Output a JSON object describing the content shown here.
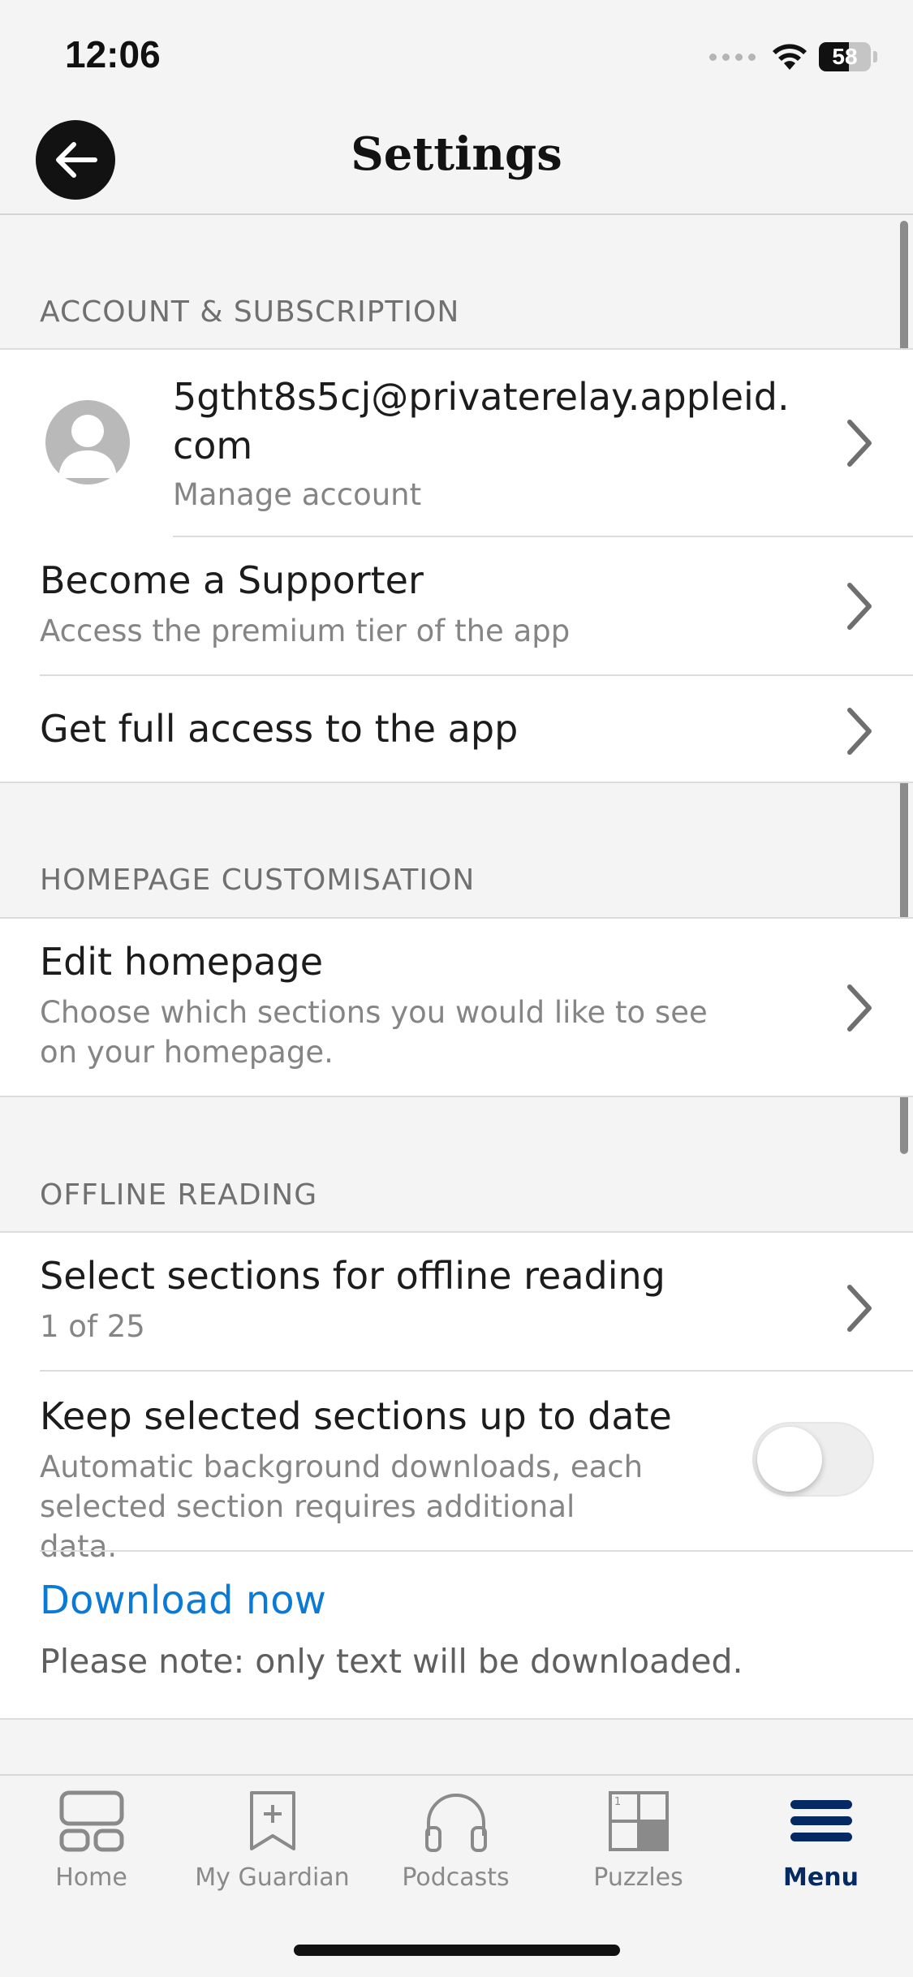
{
  "status_bar": {
    "time": "12:06",
    "battery": "58",
    "battery_level": 0.58,
    "icons": [
      "cellular-signal-icon",
      "wifi-icon",
      "battery-icon"
    ]
  },
  "nav": {
    "title": "Settings",
    "back_icon": "arrow-left-icon"
  },
  "account_section": {
    "header": "ACCOUNT & SUBSCRIPTION",
    "account": {
      "email": "5gtht8s5cj@privaterelay.appleid.com",
      "subtitle": "Manage account"
    },
    "supporter": {
      "title": "Become a Supporter",
      "subtitle": "Access the premium tier of the app"
    },
    "full_access": {
      "title": "Get full access to the app"
    }
  },
  "homepage_section": {
    "header": "HOMEPAGE CUSTOMISATION",
    "edit": {
      "title": "Edit homepage",
      "subtitle": "Choose which sections you would like to see on your homepage."
    }
  },
  "offline_section": {
    "header": "OFFLINE READING",
    "select": {
      "title": "Select sections for offline reading",
      "subtitle": "1 of 25"
    },
    "keep_updated": {
      "title": "Keep selected sections up to date",
      "subtitle": "Automatic background downloads, each selected section requires additional data.",
      "enabled": false
    },
    "download": {
      "link": "Download now",
      "note": "Please note: only text will be downloaded."
    }
  },
  "tab_bar": {
    "active": "Menu",
    "tabs": [
      {
        "label": "Home",
        "icon": "home-icon"
      },
      {
        "label": "My Guardian",
        "icon": "bookmark-plus-icon"
      },
      {
        "label": "Podcasts",
        "icon": "headphones-icon"
      },
      {
        "label": "Puzzles",
        "icon": "crossword-icon"
      },
      {
        "label": "Menu",
        "icon": "hamburger-menu-icon"
      }
    ]
  },
  "colors": {
    "background": "#f4f4f4",
    "link_blue": "#0a7ad6",
    "guardian_navy": "#052962",
    "subtitle_gray": "#858585"
  }
}
